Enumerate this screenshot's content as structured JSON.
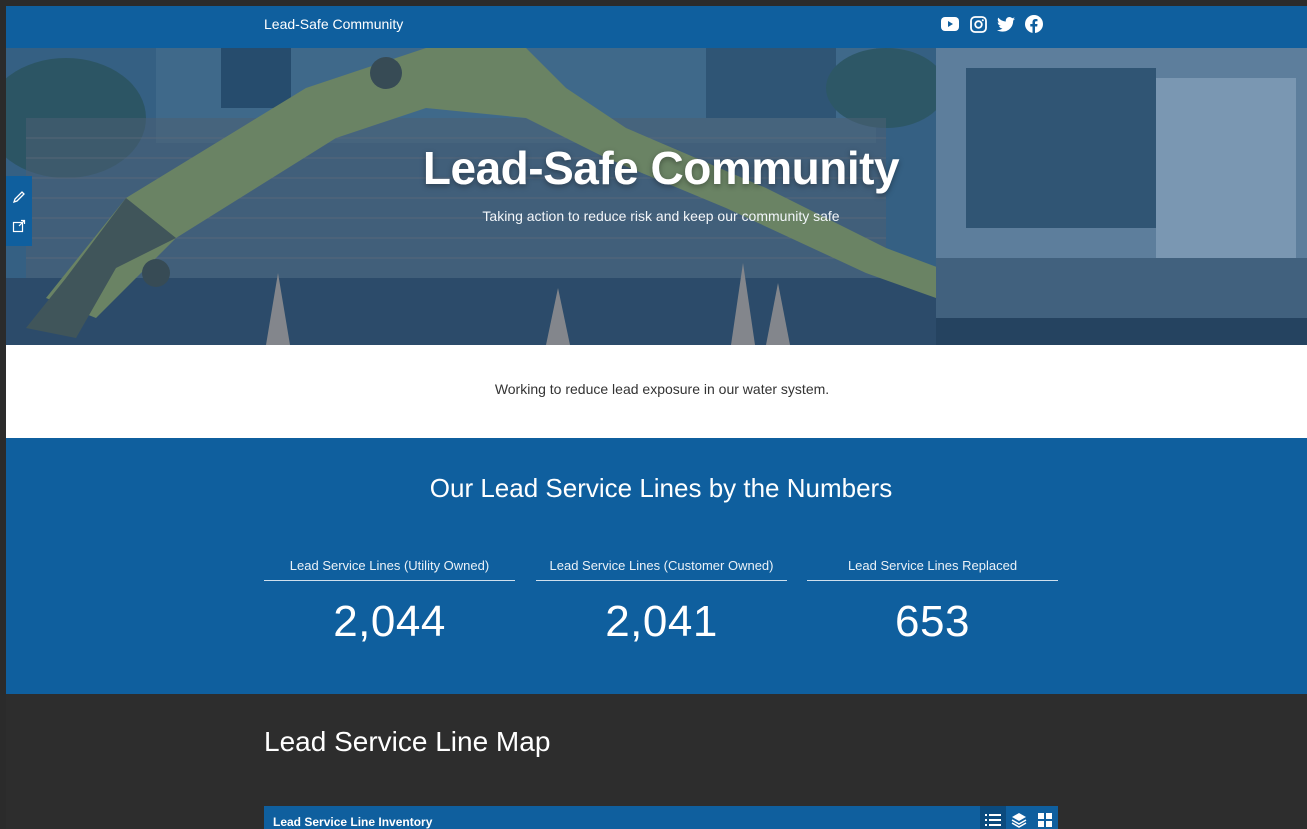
{
  "nav": {
    "site_title": "Lead-Safe Community",
    "social_icons": [
      "youtube-icon",
      "instagram-icon",
      "twitter-icon",
      "facebook-icon"
    ]
  },
  "side_tools": [
    "edit-icon",
    "share-icon"
  ],
  "hero": {
    "title": "Lead-Safe Community",
    "subtitle": "Taking action to reduce risk and keep our community safe"
  },
  "intro": {
    "text": "Working to reduce lead exposure in our water system."
  },
  "numbers": {
    "title": "Our Lead Service Lines by the Numbers",
    "stats": [
      {
        "label": "Lead Service Lines (Utility Owned)",
        "value": "2,044"
      },
      {
        "label": "Lead Service Lines (Customer Owned)",
        "value": "2,041"
      },
      {
        "label": "Lead Service Lines Replaced",
        "value": "653"
      }
    ]
  },
  "map": {
    "section_title": "Lead Service Line Map",
    "panel_title": "Lead Service Line Inventory",
    "tools": [
      "legend-icon",
      "layers-icon",
      "basemap-gallery-icon"
    ]
  },
  "colors": {
    "brand_blue": "#0f5f9e",
    "dark_background": "#2d2d2d",
    "white": "#ffffff"
  }
}
